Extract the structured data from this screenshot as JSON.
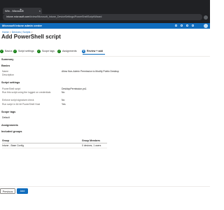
{
  "browser": {
    "tab_title": "Win - Microsoft",
    "tab_close": "×",
    "new_tab": "+",
    "address_host": "intune.microsoft.com",
    "address_path": "/#view/Microsoft_Intune_DeviceSettings/PowerShellScriptWizard"
  },
  "portal": {
    "name": "Microsoft Intune admin center"
  },
  "breadcrumb": {
    "home": "Home",
    "devices": "Devices | Scripts",
    "sep": ">"
  },
  "page": {
    "title": "Add PowerShell script"
  },
  "steps": [
    {
      "num": "✓",
      "label": "Basics"
    },
    {
      "num": "✓",
      "label": "Script settings"
    },
    {
      "num": "✓",
      "label": "Scope tags"
    },
    {
      "num": "✓",
      "label": "Assignments"
    },
    {
      "num": "5",
      "label": "Review + add"
    }
  ],
  "summary": {
    "heading": "Summary",
    "basics_heading": "Basics",
    "name_label": "Name",
    "name_value": "Allow Non-Admin Permission to Modify Public Desktop",
    "description_label": "Description",
    "description_value": "",
    "script_heading": "Script settings",
    "settings": [
      {
        "label": "PowerShell script",
        "value": "DesktopPermission.ps1"
      },
      {
        "label": "Run this script using the logged on credentials",
        "value": "No"
      },
      {
        "label": "Enforce script signature check",
        "value": "No"
      },
      {
        "label": "Run script in 64 bit PowerShell Host",
        "value": "Yes"
      }
    ],
    "scope_heading": "Scope tags",
    "scope_value": "Default",
    "assign_heading": "Assignments",
    "included_heading": "Included groups",
    "table": {
      "col_group": "Group",
      "col_members": "Group Members",
      "rows": [
        {
          "group": "Intune - Base Config",
          "members": "0 devices, 1 users"
        }
      ]
    }
  },
  "footer": {
    "previous": "Previous",
    "add": "Add"
  }
}
